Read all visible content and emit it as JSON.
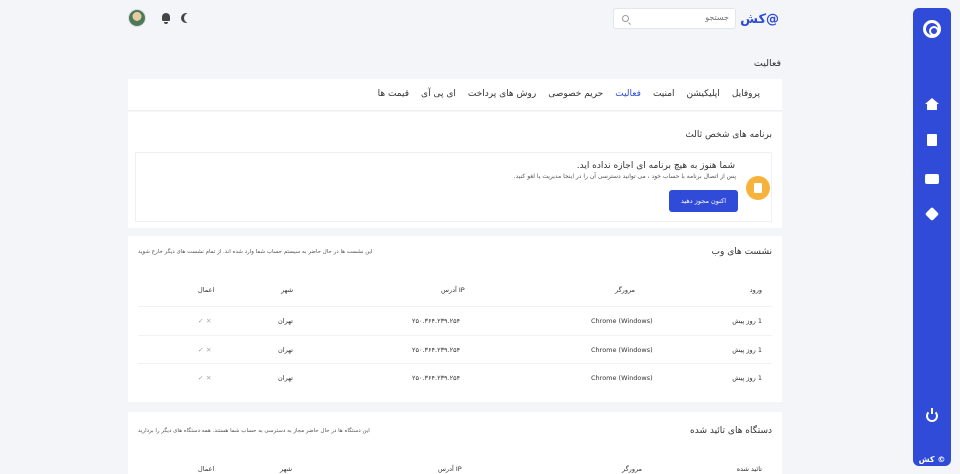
{
  "sidebar": {
    "brand": "© کش",
    "items": [
      {
        "icon": "home-icon"
      },
      {
        "icon": "document-icon"
      },
      {
        "icon": "wallet-icon"
      },
      {
        "icon": "tag-icon"
      }
    ],
    "logout_icon": "power-icon"
  },
  "topbar": {
    "brand": "@کش",
    "search_placeholder": "جستجو"
  },
  "page_title": "فعالیت",
  "tabs": [
    "پروفایل",
    "اپلیکیشن",
    "امنیت",
    "فعالیت",
    "حریم خصوصی",
    "روش های پرداخت",
    "ای پی آی",
    "قیمت ها"
  ],
  "active_tab": "فعالیت",
  "third_party": {
    "title": "برنامه های شخص ثالث",
    "heading": "شما هنوز به هیچ برنامه ای اجازه نداده اید.",
    "subtext": "پس از اتصال برنامه با حساب خود ، می توانید دسترسی آن را در اینجا مدیریت یا لغو کنید.",
    "button": "اکنون مجوز دهید"
  },
  "web_sessions": {
    "title": "نشست های وب",
    "note": "این نشست ها در حال حاضر به سیستم حساب شما وارد شده اند. از تمام نشست های دیگر خارج شوید",
    "headers": {
      "login": "ورود",
      "browser": "مرورگر",
      "ip": "IP آدرس",
      "city": "شهر",
      "actions": "اعمال"
    },
    "rows": [
      {
        "login": "1 روز پیش",
        "browser": "Chrome (Windows)",
        "ip": "۲۵۰.۳۶۴.۲۳۹.۲۵۴",
        "city": "تهران"
      },
      {
        "login": "1 روز پیش",
        "browser": "Chrome (Windows)",
        "ip": "۲۵۰.۳۶۴.۲۳۹.۲۵۴",
        "city": "تهران"
      },
      {
        "login": "1 روز پیش",
        "browser": "Chrome (Windows)",
        "ip": "۲۵۰.۳۶۴.۲۳۹.۲۵۴",
        "city": "تهران"
      }
    ]
  },
  "devices": {
    "title": "دستگاه های تائید شده",
    "note": "این دستگاه ها در حال حاضر مجاز به دسترسی به حساب شما هستند. همه دستگاه های دیگر را بردارید",
    "headers": {
      "login": "تائید شده",
      "browser": "مرورگر",
      "ip": "IP آدرس",
      "city": "شهر",
      "actions": "اعمال"
    }
  },
  "colors": {
    "accent": "#2f4bd8",
    "badge": "#f6b23a"
  }
}
